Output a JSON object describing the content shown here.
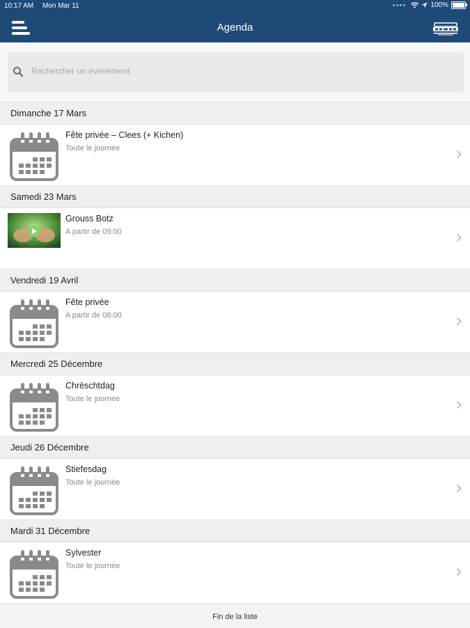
{
  "status_bar": {
    "time": "10:17 AM",
    "date": "Mon Mar 11",
    "battery": "100%"
  },
  "header": {
    "title": "Agenda",
    "menu_icon": "hamburger-menu-icon",
    "logo_icon": "app-logo-icon",
    "background": "#1f4a78"
  },
  "search": {
    "placeholder": "Rechercher un évènement",
    "value": ""
  },
  "days": [
    {
      "label": "Dimanche 17 Mars",
      "event": {
        "name": "Fête privée – Clees (+ Kichen)",
        "time": "Toute le journée",
        "thumb": "calendar"
      }
    },
    {
      "label": "Samedi 23 Mars",
      "event": {
        "name": "Grouss Botz",
        "time": "A partir de 09:00",
        "thumb": "photo"
      }
    },
    {
      "label": "Vendredi 19 Avril",
      "event": {
        "name": "Fête privée",
        "time": "A partir de 08:00",
        "thumb": "calendar"
      }
    },
    {
      "label": "Mercredi 25 Décembre",
      "event": {
        "name": "Chrëschtdag",
        "time": "Toute le journée",
        "thumb": "calendar"
      }
    },
    {
      "label": "Jeudi 26 Décembre",
      "event": {
        "name": "Stiefesdag",
        "time": "Toute le journée",
        "thumb": "calendar"
      }
    },
    {
      "label": "Mardi 31 Décembre",
      "event": {
        "name": "Sylvester",
        "time": "Toute le journée",
        "thumb": "calendar"
      }
    }
  ],
  "footer": {
    "text": "Fin de la liste"
  }
}
